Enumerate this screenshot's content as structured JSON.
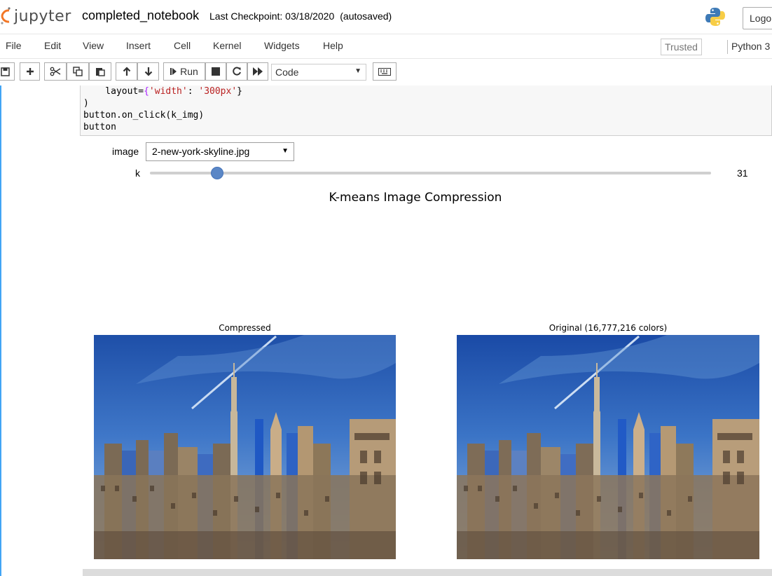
{
  "header": {
    "logo_text": "jupyter",
    "notebook_name": "completed_notebook",
    "checkpoint_label": "Last Checkpoint: 03/18/2020",
    "autosave_label": "(autosaved)",
    "logout_label": "Logo"
  },
  "menubar": {
    "items": [
      "File",
      "Edit",
      "View",
      "Insert",
      "Cell",
      "Kernel",
      "Widgets",
      "Help"
    ],
    "trusted_label": "Trusted",
    "kernel_name": "Python 3"
  },
  "toolbar": {
    "run_label": "Run",
    "cell_type": "Code",
    "icons": [
      "save-icon",
      "plus-icon",
      "cut-icon",
      "copy-icon",
      "paste-icon",
      "arrow-up-icon",
      "arrow-down-icon",
      "run-icon",
      "stop-icon",
      "restart-icon",
      "fast-forward-icon",
      "keyboard-icon"
    ]
  },
  "code": {
    "lines": [
      "    layout={'width': '300px'}",
      ")",
      "button.on_click(k_img)",
      "button"
    ]
  },
  "widgets": {
    "image_label": "image",
    "image_value": "2-new-york-skyline.jpg",
    "k_label": "k",
    "k_value": "31",
    "k_fraction": 0.12
  },
  "plot": {
    "title": "K-means Image Compression",
    "left_title": "Compressed",
    "right_title": "Original (16,777,216 colors)"
  },
  "colors": {
    "accent": "#42a5f5",
    "slider": "#5b87c6"
  }
}
